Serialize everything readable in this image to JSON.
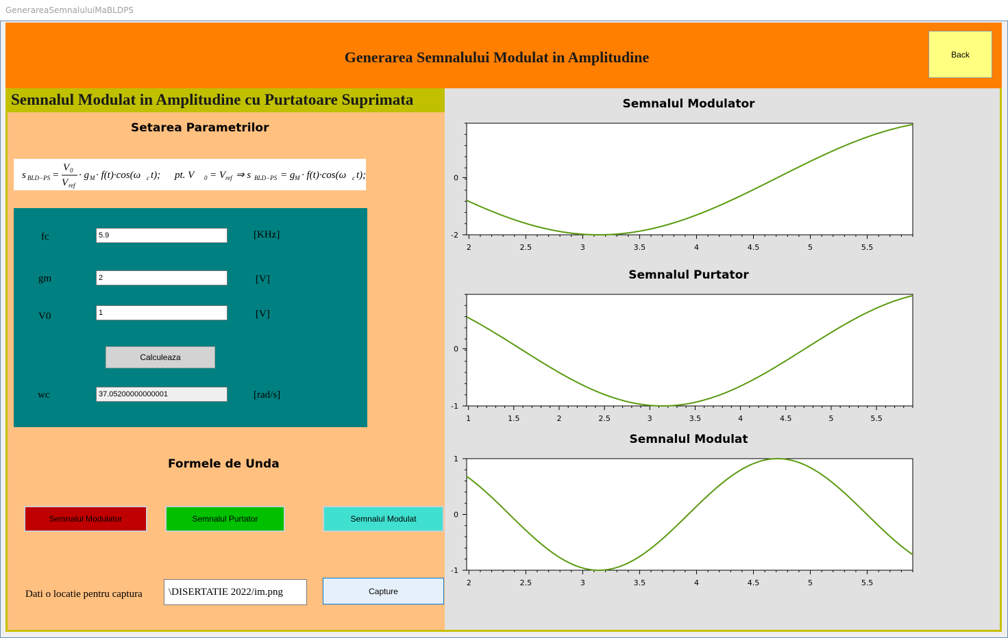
{
  "window": {
    "title": "GenerareaSemnaluluiMaBLDPS"
  },
  "header": {
    "title": "Generarea Semnalului Modulat in Amplitudine",
    "back_label": "Back",
    "color": "#ff7f00"
  },
  "left": {
    "subheader": "Semnalul Modulat in Amplitudine cu Purtatoare Suprimata",
    "params_title": "Setarea Parametrilor",
    "formula": {
      "part1": "s",
      "sub1": "BLD−PS",
      "eq": "=",
      "num": "V",
      "num_sub": "0",
      "den": "V",
      "den_sub": "ref",
      "rest": "· g",
      "rest_sub": "M",
      "rest2": "· f(t)·cos(ω",
      "rest2_sub": "c",
      "rest3": "t);",
      "cond": "pt.  V",
      "cond_sub": "0",
      "cond2": "= V",
      "cond2_sub": "ref",
      "arrow": "⇒ s",
      "arrow_sub": "BLD−PS",
      "final": "= g",
      "final_sub": "M",
      "final2": "· f(t)·cos(ω",
      "final2_sub": "c",
      "final3": "t);"
    },
    "params": {
      "fc": {
        "label": "fc",
        "value": "5.9",
        "unit": "[KHz]"
      },
      "gm": {
        "label": "gm",
        "value": "2",
        "unit": "[V]"
      },
      "v0": {
        "label": "V0",
        "value": "1",
        "unit": "[V]"
      },
      "calc_label": "Calculeaza",
      "wc": {
        "label": "wc",
        "value": "37.05200000000001",
        "unit": "[rad/s]"
      }
    },
    "waves_title": "Formele de Unda",
    "buttons": {
      "modulator": "Semnalul Modulator",
      "purtator": "Semnalul Purtator",
      "modulat": "Semnalul Modulat"
    },
    "capture": {
      "label": "Dati o locatie pentru captura",
      "path": "\\DISERTATIE 2022/im.png",
      "button": "Capture"
    }
  },
  "colors": {
    "teal": "#008080",
    "line": "#5a9a10",
    "btn_red": "#c00000",
    "btn_green": "#00c000",
    "btn_cyan": "#40e0d0"
  },
  "chart_data": [
    {
      "type": "line",
      "title": "Semnalul Modulator",
      "function": "2*cos(x)",
      "xlim": [
        1.98,
        5.9
      ],
      "ylim": [
        -2.0,
        1.9
      ],
      "xticks": [
        2,
        2.5,
        3,
        3.5,
        4,
        4.5,
        5,
        5.5
      ],
      "yticks": [
        -2,
        0
      ]
    },
    {
      "type": "line",
      "title": "Semnalul Purtator",
      "function": "cos(x)",
      "xlim": [
        0.98,
        5.9
      ],
      "ylim": [
        -1.0,
        0.95
      ],
      "xticks": [
        1,
        1.5,
        2,
        2.5,
        3,
        3.5,
        4,
        4.5,
        5,
        5.5
      ],
      "yticks": [
        -1,
        0
      ]
    },
    {
      "type": "line",
      "title": "Semnalul Modulat",
      "function": "-cos(2*x)",
      "xlim": [
        1.98,
        5.9
      ],
      "ylim": [
        -1.0,
        1.0
      ],
      "xticks": [
        2,
        2.5,
        3,
        3.5,
        4,
        4.5,
        5,
        5.5
      ],
      "yticks": [
        -1,
        0,
        1
      ]
    }
  ]
}
